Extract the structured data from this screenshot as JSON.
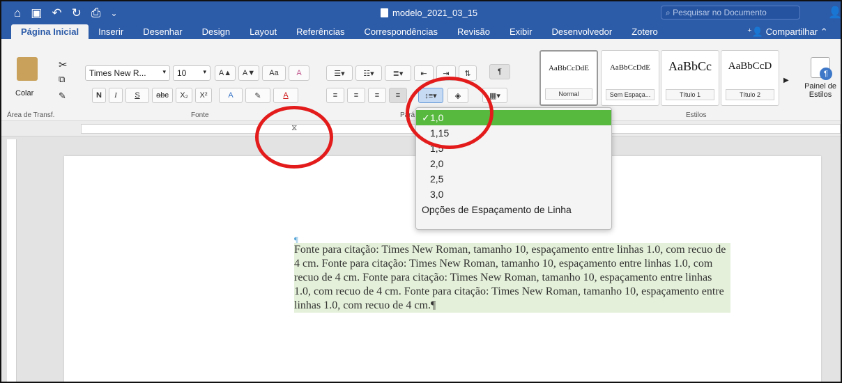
{
  "window": {
    "document_title": "modelo_2021_03_15"
  },
  "search": {
    "placeholder": "Pesquisar no Documento"
  },
  "tabs": [
    "Página Inicial",
    "Inserir",
    "Desenhar",
    "Design",
    "Layout",
    "Referências",
    "Correspondências",
    "Revisão",
    "Exibir",
    "Desenvolvedor",
    "Zotero"
  ],
  "share_label": "Compartilhar",
  "ribbon": {
    "clipboard": {
      "paste_label": "Colar",
      "group_label": "Área de Transf."
    },
    "font": {
      "name": "Times New R...",
      "size": "10",
      "group_label": "Fonte",
      "bold": "N",
      "italic": "I",
      "underline": "S"
    },
    "paragraph": {
      "group_label": "Pará"
    },
    "styles": {
      "group_label": "Estilos",
      "cards": [
        {
          "sample": "AaBbCcDdE",
          "name": "Normal"
        },
        {
          "sample": "AaBbCcDdE",
          "name": "Sem Espaça..."
        },
        {
          "sample": "AaBbCc",
          "name": "Título 1"
        },
        {
          "sample": "AaBbCcD",
          "name": "Título 2"
        }
      ]
    },
    "styles_pane_label": "Painel de Estilos"
  },
  "line_spacing_menu": {
    "items": [
      "1,0",
      "1,15",
      "1,5",
      "2,0",
      "2,5",
      "3,0",
      "Opções de Espaçamento de Linha"
    ],
    "selected": "1,0"
  },
  "document": {
    "paragraph_mark": "¶",
    "quote_text": "Fonte para citação: Times New Roman, tamanho 10, espaçamento entre linhas 1.0, com recuo de 4 cm. Fonte para citação: Times New Roman, tamanho 10, espaçamento entre linhas 1.0, com recuo de 4 cm. Fonte para citação: Times New Roman, tamanho 10, espaçamento entre linhas 1.0, com recuo de 4 cm. Fonte para citação: Times New Roman, tamanho 10, espaçamento entre linhas 1.0, com recuo de 4 cm.¶"
  },
  "colors": {
    "title_bar": "#2c5ba8",
    "highlight": "#58b93f",
    "annotation": "#e31b1b",
    "quote_bg": "#e4f0d9"
  }
}
